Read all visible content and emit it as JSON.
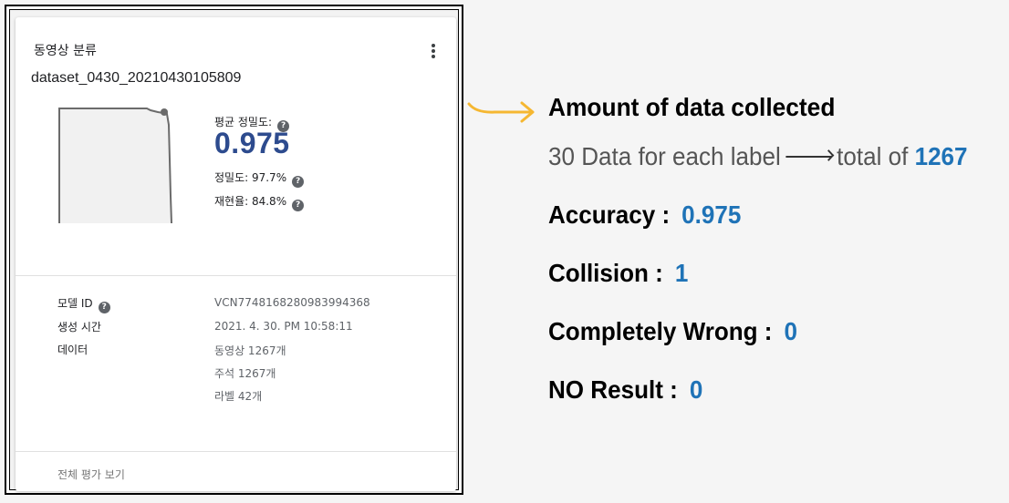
{
  "card": {
    "title": "동영상 분류",
    "dataset_name": "dataset_0430_20210430105809",
    "avg_precision_label": "평균 정밀도:",
    "avg_precision_value": "0.975",
    "precision_label": "정밀도: 97.7%",
    "recall_label": "재현율: 84.8%",
    "help_glyph": "?",
    "details": [
      {
        "key": "모델 ID",
        "value": "VCN7748168280983994368"
      },
      {
        "key": "생성 시간",
        "value": "2021. 4. 30. PM 10:58:11"
      },
      {
        "key": "데이터",
        "value": "동영상 1267개"
      },
      {
        "key": "",
        "value": "주석 1267개"
      },
      {
        "key": "",
        "value": "라벨 42개"
      }
    ],
    "footer_link": "전체 평가 보기",
    "icons": {
      "more": "more-vert-icon",
      "help": "help-circle-icon"
    }
  },
  "annotation": {
    "heading": "Amount of data collected",
    "subline_prefix": "30 Data for each label",
    "subline_mid": "total of",
    "subline_value": "1267",
    "stats": [
      {
        "label": "Accuracy :",
        "value": "0.975"
      },
      {
        "label": "Collision :",
        "value": "1"
      },
      {
        "label": "Completely Wrong :",
        "value": "0"
      },
      {
        "label": "NO Result :",
        "value": "0"
      }
    ]
  },
  "colors": {
    "accent_blue": "#1f73b7",
    "metric_blue": "#2d4b8e",
    "arrow_yellow": "#f5b731"
  }
}
